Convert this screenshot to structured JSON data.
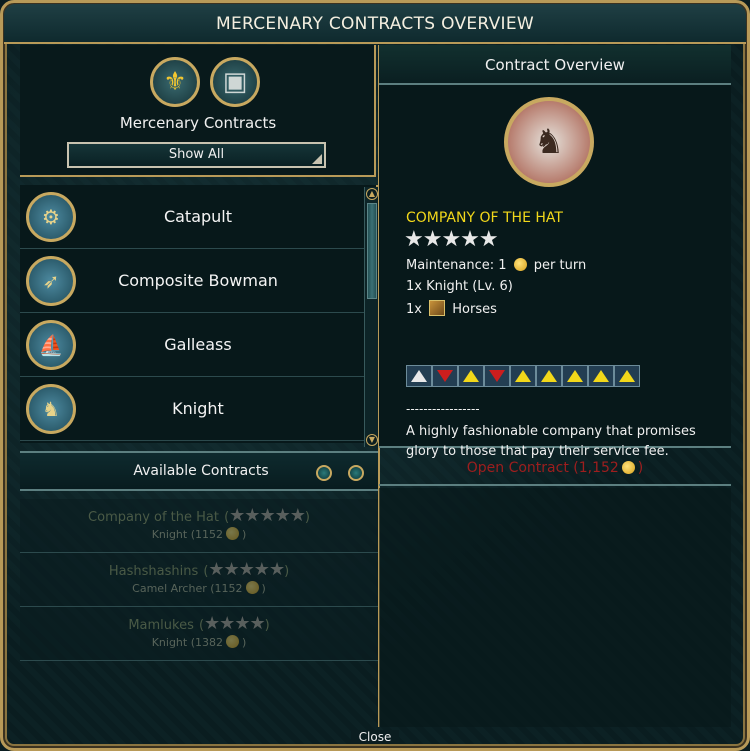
{
  "window": {
    "title": "MERCENARY CONTRACTS OVERVIEW",
    "close_label": "Close"
  },
  "left": {
    "header_title": "Mercenary Contracts",
    "filter_button": "Show All",
    "units": [
      {
        "name": "Catapult"
      },
      {
        "name": "Composite Bowman"
      },
      {
        "name": "Galleass"
      },
      {
        "name": "Knight"
      }
    ],
    "available_title": "Available Contracts",
    "contracts": [
      {
        "name": "Company of the Hat",
        "stars_open": "(",
        "stars": "★★★★★",
        "stars_close": ")",
        "unit": "Knight (1152",
        "unit_close": ")"
      },
      {
        "name": "Hashshashins",
        "stars_open": "(",
        "stars": "★★★★★",
        "stars_close": ")",
        "unit": "Camel Archer (1152",
        "unit_close": ")"
      },
      {
        "name": "Mamlukes",
        "stars_open": "(",
        "stars": "★★★★",
        "stars_close": ")",
        "unit": "Knight (1382",
        "unit_close": ")"
      }
    ]
  },
  "right": {
    "header": "Contract Overview",
    "company_name": "COMPANY OF THE HAT",
    "stars": "★★★★★",
    "maintenance_prefix": "Maintenance: 1",
    "maintenance_suffix": "per turn",
    "unit_line": "1x Knight (Lv. 6)",
    "resource_prefix": "1x",
    "resource_name": "Horses",
    "promotion_badges": [
      "up-white",
      "down",
      "up",
      "down",
      "up",
      "up",
      "up",
      "up",
      "up"
    ],
    "dashes": "-----------------",
    "description": "A highly fashionable company that promises glory to those that pay their service fee.",
    "open_contract_label": "Open Contract (1,152",
    "open_contract_close": ")"
  },
  "colors": {
    "gold_border": "#b89a58",
    "company_yellow": "#f2d81a",
    "open_red": "#9e1e1e"
  }
}
